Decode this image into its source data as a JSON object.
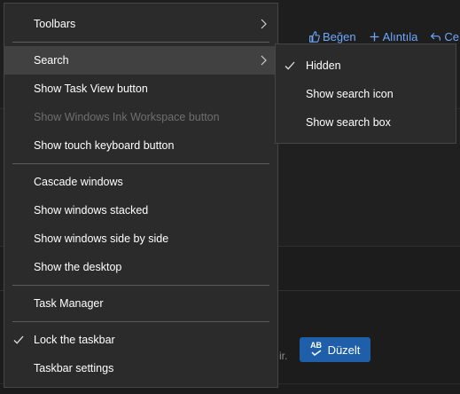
{
  "background": {
    "actions": [
      {
        "icon": "thumbs-up-icon",
        "label": "Beğen"
      },
      {
        "icon": "plus-icon",
        "label": "Alıntıla"
      },
      {
        "icon": "reply-icon",
        "label": "Ce"
      }
    ],
    "stray_text": "ir.",
    "fix_button": {
      "icon_text_top": "AB",
      "icon": "spell-check-icon",
      "label": "Düzelt"
    }
  },
  "menu": {
    "items": [
      {
        "label": "Toolbars",
        "submenu": true
      },
      {
        "label": "Search",
        "submenu": true,
        "selected": true
      },
      {
        "label": "Show Task View button"
      },
      {
        "label": "Show Windows Ink Workspace button",
        "disabled": true
      },
      {
        "label": "Show touch keyboard button"
      },
      {
        "label": "Cascade windows"
      },
      {
        "label": "Show windows stacked"
      },
      {
        "label": "Show windows side by side"
      },
      {
        "label": "Show the desktop"
      },
      {
        "label": "Task Manager"
      },
      {
        "label": "Lock the taskbar",
        "checked": true
      },
      {
        "label": "Taskbar settings"
      }
    ]
  },
  "search_submenu": {
    "items": [
      {
        "label": "Hidden",
        "checked": true
      },
      {
        "label": "Show search icon"
      },
      {
        "label": "Show search box"
      }
    ]
  },
  "colors": {
    "menu_bg": "#2b2b2b",
    "menu_selected": "#414141",
    "link_blue": "#6ea7ff",
    "button_blue": "#1f5ea8",
    "disabled_text": "#6f6f6f"
  }
}
